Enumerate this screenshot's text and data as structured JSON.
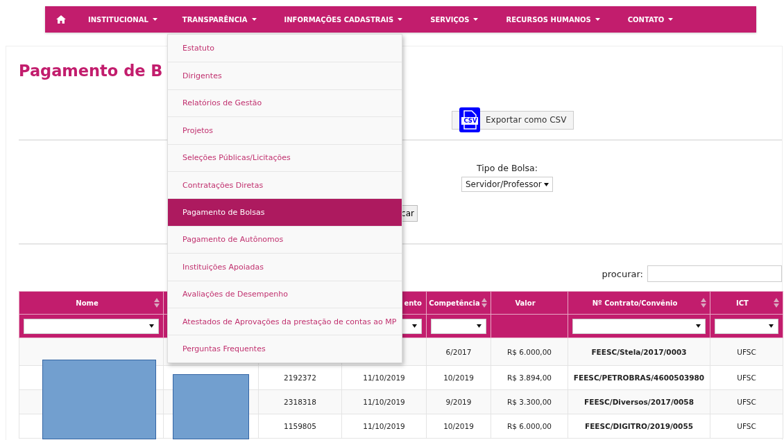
{
  "nav": {
    "items": [
      {
        "label": "INSTITUCIONAL"
      },
      {
        "label": "TRANSPARÊNCIA"
      },
      {
        "label": "INFORMAÇÕES CADASTRAIS"
      },
      {
        "label": "SERVIÇOS"
      },
      {
        "label": "RECURSOS HUMANOS"
      },
      {
        "label": "CONTATO"
      }
    ]
  },
  "menu": {
    "items": [
      {
        "label": "Estatuto",
        "selected": false
      },
      {
        "label": "Dirigentes",
        "selected": false
      },
      {
        "label": "Relatórios de Gestão",
        "selected": false
      },
      {
        "label": "Projetos",
        "selected": false
      },
      {
        "label": "Seleções Públicas/Licitações",
        "selected": false
      },
      {
        "label": "Contratações Diretas",
        "selected": false
      },
      {
        "label": "Pagamento de Bolsas",
        "selected": true
      },
      {
        "label": "Pagamento de Autônomos",
        "selected": false
      },
      {
        "label": "Instituições Apoiadas",
        "selected": false
      },
      {
        "label": "Avaliações de Desempenho",
        "selected": false
      },
      {
        "label": "Atestados de Aprovações da prestação de contas ao MP",
        "selected": false
      },
      {
        "label": "Perguntas Frequentes",
        "selected": false
      }
    ]
  },
  "page": {
    "title": "Pagamento de B",
    "export_icon_text": "CSV",
    "export_button": "Exportar como CSV",
    "filter": {
      "label": "Tipo de Bolsa:",
      "value": "Servidor/Professor",
      "button": "car"
    },
    "search": {
      "label": "procurar:"
    }
  },
  "table": {
    "columns": [
      {
        "label": "Nome",
        "sortable": true,
        "filter": true
      },
      {},
      {},
      {
        "label": "ento",
        "sortable": false,
        "filter": true
      },
      {
        "label": "Competência",
        "sortable": true,
        "filter": true
      },
      {
        "label": "Valor",
        "sortable": false,
        "filter": false
      },
      {
        "label": "Nº Contrato/Convênio",
        "sortable": true,
        "filter": true
      },
      {
        "label": "ICT",
        "sortable": true,
        "filter": true
      }
    ],
    "rows": [
      {
        "cells": [
          null,
          null,
          null,
          null,
          "6/2017",
          "R$ 6.000,00",
          "FEESC/Stela/2017/0003",
          "UFSC"
        ]
      },
      {
        "cells": [
          null,
          null,
          "2192372",
          "11/10/2019",
          "10/2019",
          "R$ 3.894,00",
          "FEESC/PETROBRAS/4600503980",
          "UFSC"
        ]
      },
      {
        "cells": [
          null,
          null,
          "2318318",
          "11/10/2019",
          "9/2019",
          "R$ 3.300,00",
          "FEESC/Diversos/2017/0058",
          "UFSC"
        ]
      },
      {
        "cells": [
          null,
          null,
          "1159805",
          "11/10/2019",
          "10/2019",
          "R$ 6.000,00",
          "FEESC/DIGITRO/2019/0055",
          "UFSC"
        ]
      }
    ]
  }
}
